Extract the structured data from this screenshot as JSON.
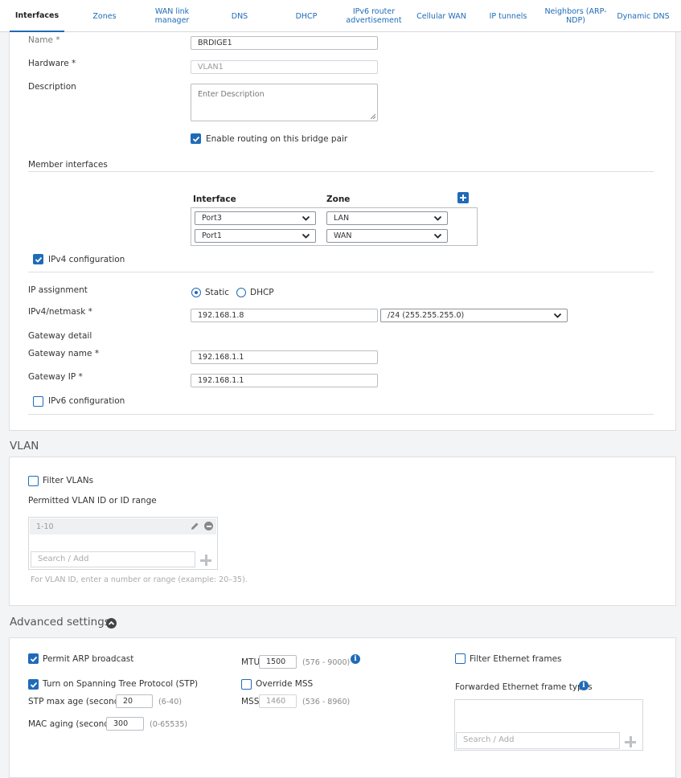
{
  "tabs": [
    {
      "label": "Interfaces",
      "active": true
    },
    {
      "label": "Zones"
    },
    {
      "label": "WAN link manager"
    },
    {
      "label": "DNS"
    },
    {
      "label": "DHCP"
    },
    {
      "label": "IPv6 router advertisement"
    },
    {
      "label": "Cellular WAN"
    },
    {
      "label": "IP tunnels"
    },
    {
      "label": "Neighbors (ARP-NDP)"
    },
    {
      "label": "Dynamic DNS"
    }
  ],
  "general": {
    "name_label": "Name *",
    "name_value": "BRDIGE1",
    "hardware_label": "Hardware *",
    "hardware_value": "VLAN1",
    "description_label": "Description",
    "description_placeholder": "Enter Description",
    "routing_label": "Enable routing on this bridge pair",
    "routing_checked": true
  },
  "members": {
    "title": "Member interfaces",
    "col_interface": "Interface",
    "col_zone": "Zone",
    "rows": [
      {
        "interface": "Port3",
        "zone": "LAN"
      },
      {
        "interface": "Port1",
        "zone": "WAN"
      }
    ]
  },
  "ipv4": {
    "label": "IPv4 configuration",
    "checked": true,
    "assignment_label": "IP assignment",
    "static_label": "Static",
    "dhcp_label": "DHCP",
    "selected": "Static",
    "netmask_label": "IPv4/netmask *",
    "ip_value": "192.168.1.8",
    "mask_value": "/24 (255.255.255.0)",
    "gateway_detail_label": "Gateway detail",
    "gateway_name_label": "Gateway name  *",
    "gateway_name_value": "192.168.1.1",
    "gateway_ip_label": "Gateway IP  *",
    "gateway_ip_value": "192.168.1.1"
  },
  "ipv6": {
    "label": "IPv6 configuration",
    "checked": false
  },
  "vlan": {
    "section_title": "VLAN",
    "filter_label": "Filter VLANs",
    "filter_checked": false,
    "permitted_label": "Permitted VLAN ID or ID range",
    "items": [
      "1-10"
    ],
    "search_placeholder": "Search / Add",
    "hint": "For VLAN ID, enter a number or range (example: 20–35)."
  },
  "advanced": {
    "section_title": "Advanced settings",
    "arp_label": "Permit ARP broadcast",
    "arp_checked": true,
    "stp_label": "Turn on Spanning Tree Protocol (STP)",
    "stp_checked": true,
    "stp_max_age_label": "STP max age (seconds)",
    "stp_max_age_value": "20",
    "stp_max_age_range": "(6-40)",
    "mac_aging_label": "MAC aging (seconds)",
    "mac_aging_value": "300",
    "mac_aging_range": "(0-65535)",
    "mtu_label": "MTU",
    "mtu_value": "1500",
    "mtu_range": "(576 - 9000)",
    "override_mss_label": "Override MSS",
    "override_mss_checked": false,
    "mss_label": "MSS",
    "mss_value": "1460",
    "mss_range": "(536 - 8960)",
    "filter_eth_label": "Filter Ethernet frames",
    "filter_eth_checked": false,
    "forwarded_label": "Forwarded Ethernet frame types",
    "forwarded_search_placeholder": "Search / Add"
  },
  "colors": {
    "accent": "#1f6bb8",
    "border": "#dcdfe3",
    "background": "#f3f4f6"
  }
}
